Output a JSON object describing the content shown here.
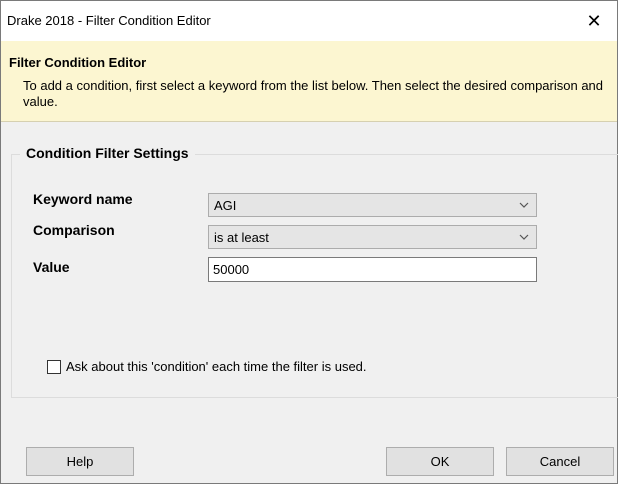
{
  "window": {
    "title": "Drake 2018 - Filter Condition Editor",
    "close_glyph": "✕"
  },
  "banner": {
    "heading": "Filter Condition Editor",
    "description": "To add a condition, first select a keyword from the list below. Then select the desired comparison and value."
  },
  "settings": {
    "group_title": "Condition Filter Settings",
    "keyword": {
      "label": "Keyword name",
      "value": "AGI"
    },
    "comparison": {
      "label": "Comparison",
      "value": "is at least"
    },
    "value": {
      "label": "Value",
      "value": "50000"
    }
  },
  "ask_checkbox": {
    "label": "Ask about this 'condition' each time the filter is used.",
    "checked": false
  },
  "buttons": {
    "help": "Help",
    "ok": "OK",
    "cancel": "Cancel"
  },
  "icons": {
    "combo_arrow": "chevron-down-icon",
    "close": "close-icon"
  }
}
